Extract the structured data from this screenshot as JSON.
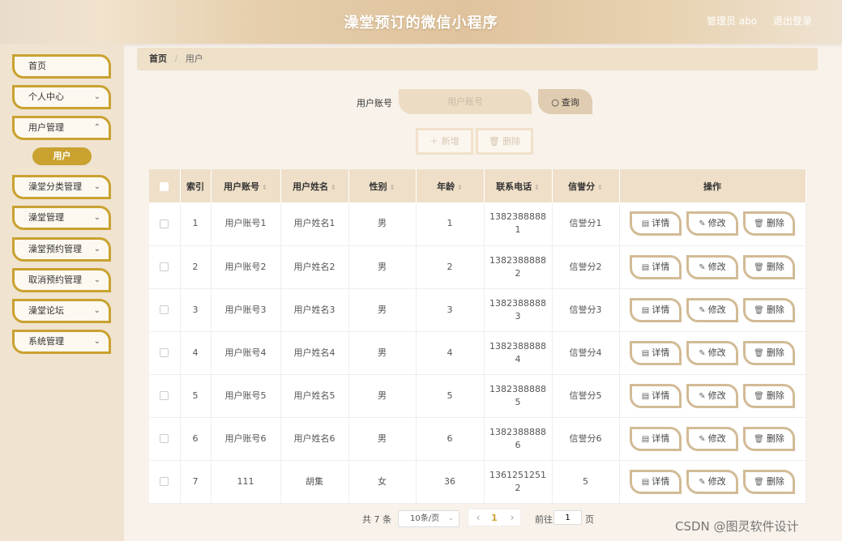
{
  "header": {
    "title": "澡堂预订的微信小程序",
    "user": "管理员 abo",
    "logout": "退出登录"
  },
  "sidebar": {
    "items": [
      {
        "label": "首页"
      },
      {
        "label": "个人中心"
      },
      {
        "label": "用户管理"
      },
      {
        "label": "澡堂分类管理"
      },
      {
        "label": "澡堂管理"
      },
      {
        "label": "澡堂预约管理"
      },
      {
        "label": "取消预约管理"
      },
      {
        "label": "澡堂论坛"
      },
      {
        "label": "系统管理"
      }
    ],
    "active_sub": "用户",
    "chevron_icon": "chevron-down-icon"
  },
  "breadcrumb": {
    "home": "首页",
    "separator": "/",
    "current": "用户"
  },
  "search": {
    "label": "用户账号",
    "placeholder": "用户账号",
    "button": "查询"
  },
  "actions": {
    "add": "＋ 新增",
    "delete": "🗑 删除"
  },
  "table": {
    "headers": [
      "索引",
      "用户账号",
      "用户姓名",
      "性别",
      "年龄",
      "联系电话",
      "信誉分",
      "操作"
    ],
    "rows": [
      {
        "index": "1",
        "account": "用户账号1",
        "name": "用户姓名1",
        "gender": "男",
        "age": "1",
        "phone_a": "1382388888",
        "phone_b": "1",
        "credit": "信誉分1"
      },
      {
        "index": "2",
        "account": "用户账号2",
        "name": "用户姓名2",
        "gender": "男",
        "age": "2",
        "phone_a": "1382388888",
        "phone_b": "2",
        "credit": "信誉分2"
      },
      {
        "index": "3",
        "account": "用户账号3",
        "name": "用户姓名3",
        "gender": "男",
        "age": "3",
        "phone_a": "1382388888",
        "phone_b": "3",
        "credit": "信誉分3"
      },
      {
        "index": "4",
        "account": "用户账号4",
        "name": "用户姓名4",
        "gender": "男",
        "age": "4",
        "phone_a": "1382388888",
        "phone_b": "4",
        "credit": "信誉分4"
      },
      {
        "index": "5",
        "account": "用户账号5",
        "name": "用户姓名5",
        "gender": "男",
        "age": "5",
        "phone_a": "1382388888",
        "phone_b": "5",
        "credit": "信誉分5"
      },
      {
        "index": "6",
        "account": "用户账号6",
        "name": "用户姓名6",
        "gender": "男",
        "age": "6",
        "phone_a": "1382388888",
        "phone_b": "6",
        "credit": "信誉分6"
      },
      {
        "index": "7",
        "account": "111",
        "name": "胡集",
        "gender": "女",
        "age": "36",
        "phone_a": "1361251251",
        "phone_b": "2",
        "credit": "5"
      }
    ],
    "ops": {
      "detail": "详情",
      "edit": "修改",
      "delete": "删除"
    }
  },
  "pagination": {
    "total": "共 7 条",
    "page_size": "10条/页",
    "current_page": "1",
    "goto_label": "前往",
    "goto_value": "1",
    "goto_unit": "页"
  },
  "watermark": "CSDN @图灵软件设计",
  "colors": {
    "accent": "#c9a230",
    "header_bg": "#dfc39d",
    "sidebar_bg": "#f0e3d0",
    "table_head": "#efdfc8",
    "op_border": "#d2bb96"
  }
}
